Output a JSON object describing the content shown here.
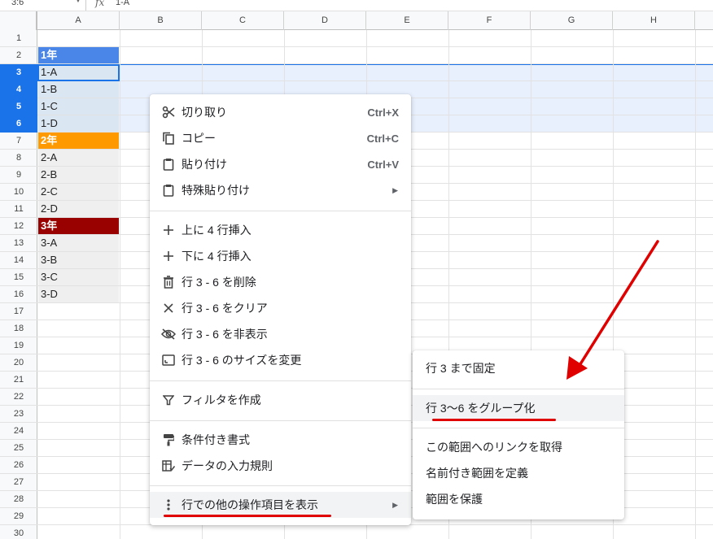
{
  "formula_bar": {
    "name_box": "3:6",
    "fx": "fx",
    "value": "1-A"
  },
  "columns": [
    "A",
    "B",
    "C",
    "D",
    "E",
    "F",
    "G",
    "H"
  ],
  "rows": [
    "1",
    "2",
    "3",
    "4",
    "5",
    "6",
    "7",
    "8",
    "9",
    "10",
    "11",
    "12",
    "13",
    "14",
    "15",
    "16",
    "17",
    "18",
    "19",
    "20",
    "21",
    "22",
    "23",
    "24",
    "25",
    "26",
    "27",
    "28",
    "29",
    "30"
  ],
  "selected_rows": [
    "3",
    "4",
    "5",
    "6"
  ],
  "cells": [
    {
      "row": 2,
      "text": "1年",
      "style": "hdr y1"
    },
    {
      "row": 3,
      "text": "1-A",
      "style": "seltxt"
    },
    {
      "row": 4,
      "text": "1-B",
      "style": "seltxt"
    },
    {
      "row": 5,
      "text": "1-C",
      "style": "seltxt"
    },
    {
      "row": 6,
      "text": "1-D",
      "style": "seltxt"
    },
    {
      "row": 7,
      "text": "2年",
      "style": "hdr y2"
    },
    {
      "row": 8,
      "text": "2-A",
      "style": "grey"
    },
    {
      "row": 9,
      "text": "2-B",
      "style": "grey"
    },
    {
      "row": 10,
      "text": "2-C",
      "style": "grey"
    },
    {
      "row": 11,
      "text": "2-D",
      "style": "grey"
    },
    {
      "row": 12,
      "text": "3年",
      "style": "hdr y3"
    },
    {
      "row": 13,
      "text": "3-A",
      "style": "grey"
    },
    {
      "row": 14,
      "text": "3-B",
      "style": "grey"
    },
    {
      "row": 15,
      "text": "3-C",
      "style": "grey"
    },
    {
      "row": 16,
      "text": "3-D",
      "style": "grey"
    }
  ],
  "context_menu": {
    "items": [
      {
        "icon": "scissors-icon",
        "label": "切り取り",
        "shortcut": "Ctrl+X"
      },
      {
        "icon": "copy-icon",
        "label": "コピー",
        "shortcut": "Ctrl+C"
      },
      {
        "icon": "clipboard-icon",
        "label": "貼り付け",
        "shortcut": "Ctrl+V"
      },
      {
        "icon": "clipboard-icon",
        "label": "特殊貼り付け",
        "submenu": true
      },
      {
        "icon": "plus-icon",
        "label": "上に 4 行挿入"
      },
      {
        "icon": "plus-icon",
        "label": "下に 4 行挿入"
      },
      {
        "icon": "trash-icon",
        "label": "行 3 - 6 を削除"
      },
      {
        "icon": "x-icon",
        "label": "行 3 - 6 をクリア"
      },
      {
        "icon": "eye-off-icon",
        "label": "行 3 - 6 を非表示"
      },
      {
        "icon": "resize-icon",
        "label": "行 3 - 6 のサイズを変更"
      },
      {
        "icon": "filter-icon",
        "label": "フィルタを作成"
      },
      {
        "icon": "paint-roller-icon",
        "label": "条件付き書式"
      },
      {
        "icon": "data-validation-icon",
        "label": "データの入力規則"
      },
      {
        "icon": "more-vert-icon",
        "label": "行での他の操作項目を表示",
        "submenu": true,
        "highlighted": true
      }
    ]
  },
  "sub_menu": {
    "items": [
      {
        "label": "行 3 まで固定"
      },
      {
        "label": "行 3〜6 をグループ化",
        "highlighted": true
      },
      {
        "label": "この範囲へのリンクを取得"
      },
      {
        "label": "名前付き範囲を定義"
      },
      {
        "label": "範囲を保護"
      }
    ]
  },
  "colors": {
    "selection": "#1a73e8",
    "selection_fill": "#e8f0fe",
    "year1": "#4a86e8",
    "year2": "#ff9900",
    "year3": "#990000",
    "annotation": "#e00000"
  }
}
